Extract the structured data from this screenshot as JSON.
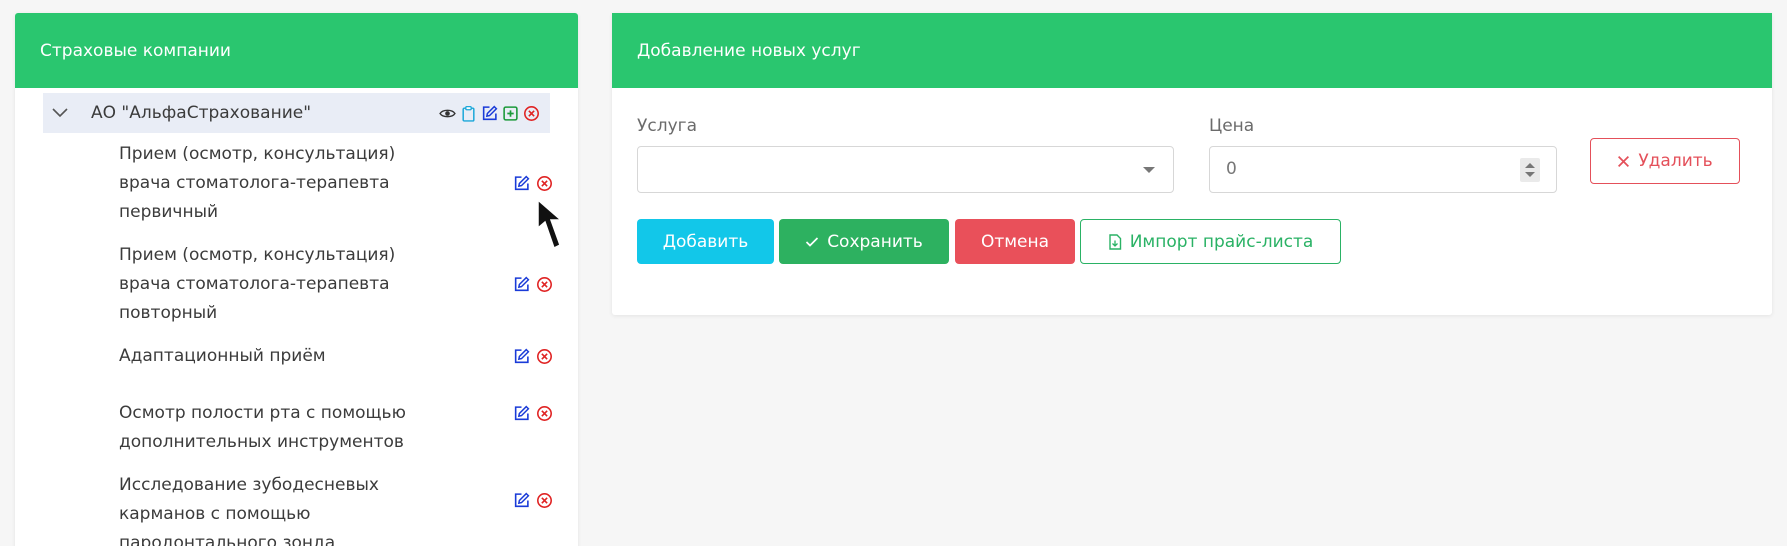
{
  "left_panel": {
    "title": "Страховые компании",
    "company": {
      "name": "АО \"АльфаСтрахование\"",
      "icons": [
        "eye-icon",
        "clipboard-icon",
        "edit-icon",
        "add-square-icon",
        "delete-icon"
      ]
    },
    "services": [
      {
        "name": "Прием (осмотр, консультация) врача стоматолога-терапевта первичный"
      },
      {
        "name": "Прием (осмотр, консультация) врача стоматолога-терапевта повторный"
      },
      {
        "name": "Адаптационный приём"
      },
      {
        "name": "Осмотр полости рта с помощью дополнительных инструментов"
      },
      {
        "name": "Исследование зубодесневых карманов с помощью пародонтального зонда"
      }
    ]
  },
  "right_panel": {
    "title": "Добавление новых услуг",
    "service_label": "Услуга",
    "service_value": "",
    "price_label": "Цена",
    "price_value": "0",
    "delete_label": "Удалить",
    "add_label": "Добавить",
    "save_label": "Сохранить",
    "cancel_label": "Отмена",
    "import_label": "Импорт прайс-листа"
  },
  "colors": {
    "header_green": "#2ac66f",
    "edit_blue": "#1a3bd8",
    "delete_red": "#e02424",
    "add_cyan": "#12c7e9",
    "save_green": "#2db160",
    "cancel_red": "#e9505a"
  }
}
